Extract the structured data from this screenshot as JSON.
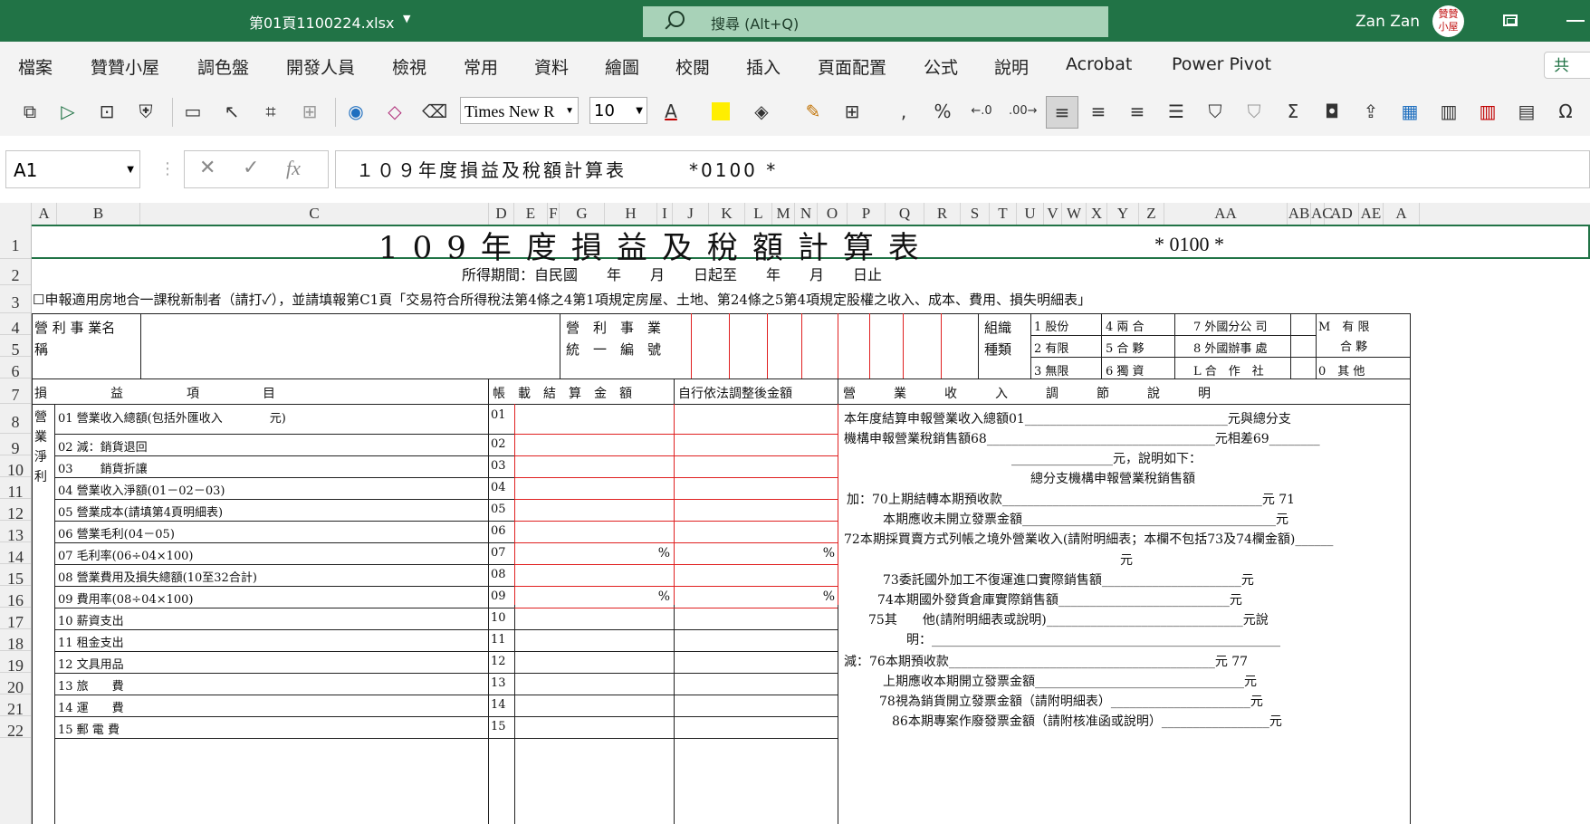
{
  "titlebar": {
    "filename": "第01頁1100224.xlsx",
    "search_placeholder": "搜尋 (Alt+Q)",
    "user": "Zan Zan",
    "avatar_text": "贊贊小屋"
  },
  "menu": [
    "檔案",
    "贊贊小屋",
    "調色盤",
    "開發人員",
    "檢視",
    "常用",
    "資料",
    "繪圖",
    "校閱",
    "插入",
    "頁面配置",
    "公式",
    "說明",
    "Acrobat",
    "Power Pivot"
  ],
  "share_label": "共",
  "toolbar": {
    "font": "Times New R",
    "size": "10"
  },
  "formula_bar": {
    "cell": "A1",
    "fx": "fx",
    "content": "１０９年度損益及稅額計算表　　　*0100 *"
  },
  "columns": [
    "A",
    "B",
    "C",
    "D",
    "E",
    "F",
    "G",
    "H",
    "I",
    "J",
    "K",
    "L",
    "M",
    "N",
    "O",
    "P",
    "Q",
    "R",
    "S",
    "T",
    "U",
    "V",
    "W",
    "X",
    "Y",
    "Z",
    "AA",
    "AB",
    "AC",
    "AD",
    "AE",
    "A"
  ],
  "rows": [
    "1",
    "2",
    "3",
    "4",
    "5",
    "6",
    "7",
    "8",
    "9",
    "10",
    "11",
    "12",
    "13",
    "14",
    "15",
    "16",
    "17",
    "18",
    "19",
    "20",
    "21",
    "22"
  ],
  "form": {
    "title": "109年度損益及稅額計算表",
    "code": "* 0100 *",
    "period": "所得期間：自民國　　年　　月　　日起至　　年　　月　　日止",
    "row3": "☐申報適用房地合一課稅新制者（請打✓），並請填報第C1頁「交易符合所得稅法第4條之4第1項規定房屋、土地、第24條之5第4項規定股權之收入、成本、費用、損失明細表」",
    "biz_name_1": "營 利 事 業名",
    "biz_name_2": "稱",
    "biz_id_1": "營　利　事　業",
    "biz_id_2": "統　一　編　號",
    "org_1": "組織",
    "org_2": "種類",
    "org_types": [
      "1 股份",
      "4 兩 合",
      "7 外國分公 司",
      "M　有 限",
      "2 有限",
      "5 合 夥",
      "8 外國辦事 處",
      "合 夥",
      "3 無限",
      "6 獨 資",
      "L 合　作　社",
      "0　其 他"
    ],
    "hdr_item": "損　　　　　益　　　　　項　　　　　目",
    "hdr_book": "帳　載　結　算　金　額",
    "hdr_adj": "自行依法調整後金額",
    "hdr_note": "營　　　業　　　收　　　入　　　調　　　節　　　說　　　明",
    "side_label": "營業淨利",
    "items": [
      {
        "no": "01",
        "label": "01 營業收入總額(包括外匯收入　　　　元)",
        "book": "",
        "adj": ""
      },
      {
        "no": "02",
        "label": "02 減：銷貨退回",
        "book": "",
        "adj": ""
      },
      {
        "no": "03",
        "label": "03　　 銷貨折讓",
        "book": "",
        "adj": ""
      },
      {
        "no": "04",
        "label": "04 營業收入淨額(01－02－03)",
        "book": "",
        "adj": ""
      },
      {
        "no": "05",
        "label": "05 營業成本(請填第4頁明細表)",
        "book": "",
        "adj": ""
      },
      {
        "no": "06",
        "label": "06 營業毛利(04－05)",
        "book": "",
        "adj": ""
      },
      {
        "no": "07",
        "label": "07 毛利率(06÷04×100)",
        "book": "%",
        "adj": "%"
      },
      {
        "no": "08",
        "label": "08 營業費用及損失總額(10至32合計)",
        "book": "",
        "adj": ""
      },
      {
        "no": "09",
        "label": "09 費用率(08÷04×100)",
        "book": "%",
        "adj": "%"
      },
      {
        "no": "10",
        "label": "10 薪資支出",
        "book": "",
        "adj": ""
      },
      {
        "no": "11",
        "label": "11 租金支出",
        "book": "",
        "adj": ""
      },
      {
        "no": "12",
        "label": "12 文具用品",
        "book": "",
        "adj": ""
      },
      {
        "no": "13",
        "label": "13 旅　　費",
        "book": "",
        "adj": ""
      },
      {
        "no": "14",
        "label": "14 運　　費",
        "book": "",
        "adj": ""
      },
      {
        "no": "15",
        "label": "15 郵 電 費",
        "book": "",
        "adj": ""
      }
    ],
    "notes": [
      "本年度結算申報營業收入總額01________________________________元與總分支",
      "機構申報營業稅銷售額68____________________________________元相差69________",
      "________________元，說明如下：",
      "總分支機構申報營業稅銷售額",
      "加：70上期結轉本期預收款_________________________________________元 71",
      "本期應收未開立發票金額________________________________________元",
      "72本期採買賣方式列帳之境外營業收入(請附明細表；本欄不包括73及74欄金額)______",
      "元",
      "73委託國外加工不復運進口實際銷售額______________________元",
      "74本期國外發貨倉庫實際銷售額___________________________元",
      "75其　　他(請附明細表或說明)_______________________________元說",
      "明：_______________________________________________________",
      "減：76本期預收款__________________________________________元 77",
      "上期應收本期開立發票金額_________________________________元",
      "78視為銷貨開立發票金額（請附明細表）______________________元",
      "86本期專案作廢發票金額（請附核准函或說明）_________________元"
    ]
  }
}
